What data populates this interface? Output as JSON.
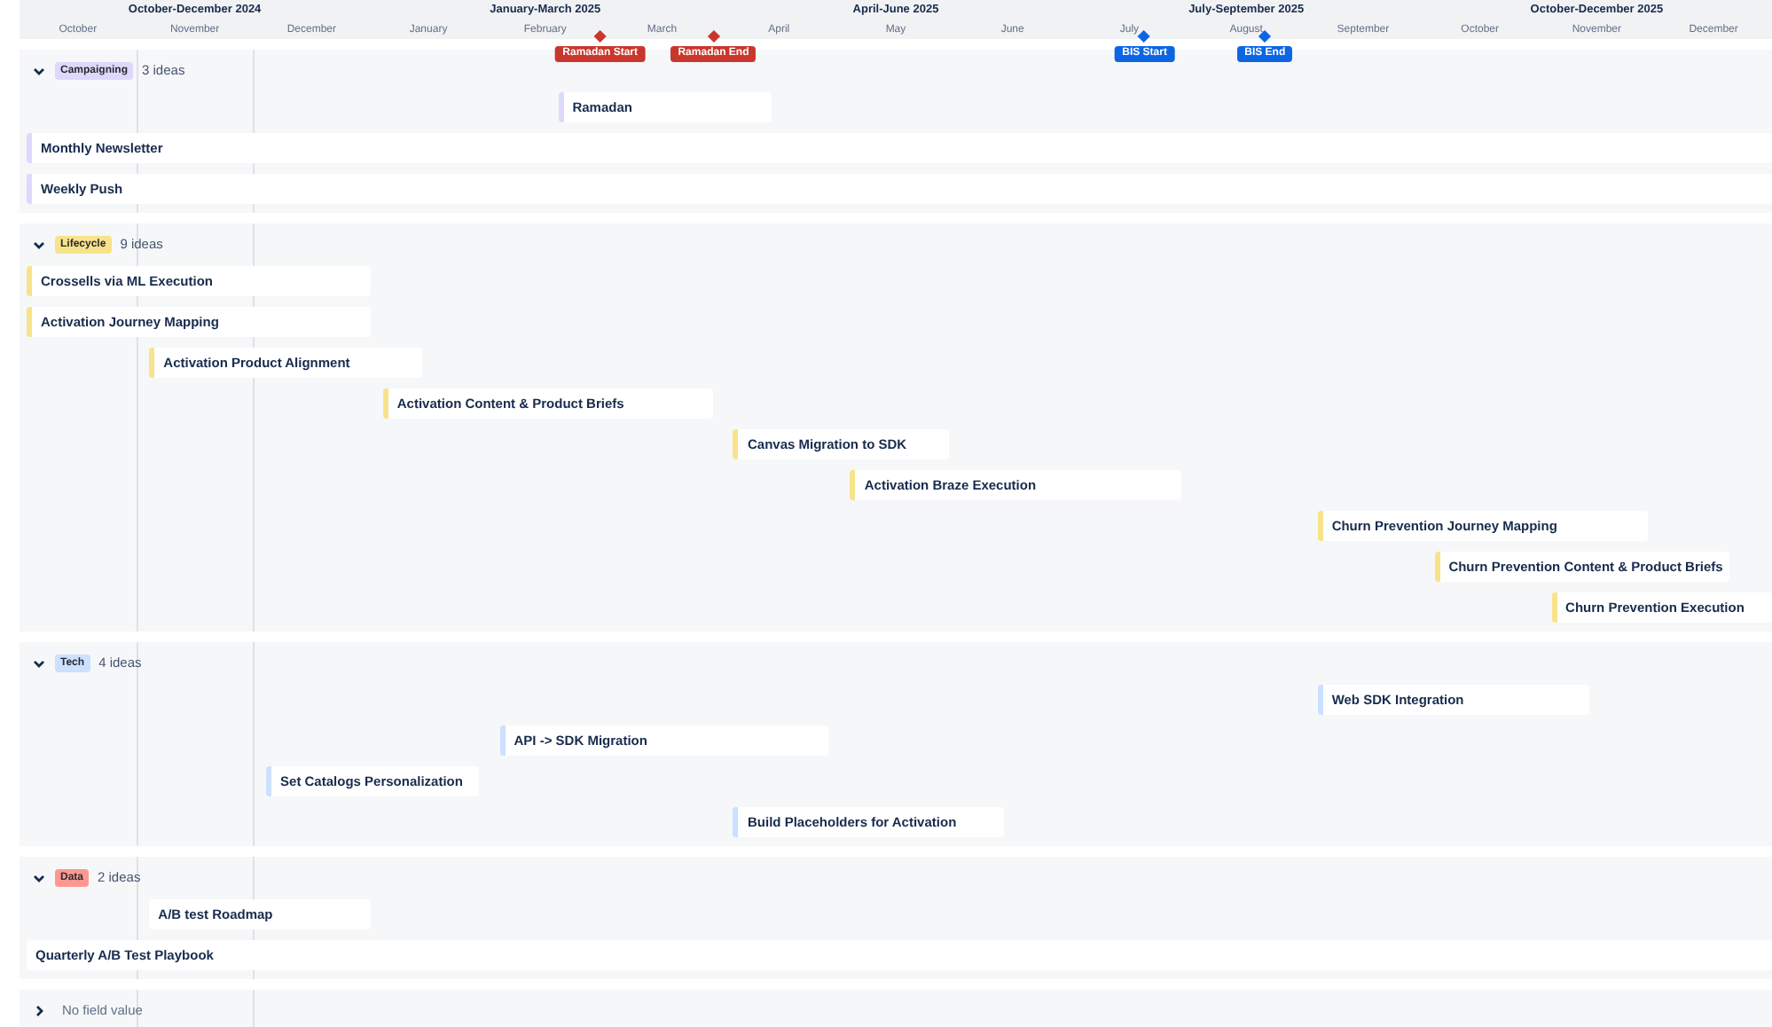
{
  "timeline": {
    "quarters": [
      {
        "label": "October-December 2024"
      },
      {
        "label": "January-March 2025"
      },
      {
        "label": "April-June 2025"
      },
      {
        "label": "July-September 2025"
      },
      {
        "label": "October-December 2025"
      }
    ],
    "months": [
      "October",
      "November",
      "December",
      "January",
      "February",
      "March",
      "April",
      "May",
      "June",
      "July",
      "August",
      "September",
      "October",
      "November",
      "December"
    ],
    "markers": [
      {
        "label": "Ramadan Start",
        "color": "#c9372c"
      },
      {
        "label": "Ramadan End",
        "color": "#c9372c"
      },
      {
        "label": "BIS Start",
        "color": "#0c66e4"
      },
      {
        "label": "BIS End",
        "color": "#0c66e4"
      }
    ]
  },
  "groups": [
    {
      "kind": "tag",
      "label": "Campaigning",
      "color": "#dfd8fd",
      "count": "3 ideas",
      "expanded": true,
      "items": [
        {
          "title": "Ramadan",
          "stripe": true
        },
        {
          "title": "Monthly Newsletter",
          "stripe": true
        },
        {
          "title": "Weekly Push",
          "stripe": true
        }
      ]
    },
    {
      "kind": "tag",
      "label": "Lifecycle",
      "color": "#f8e38b",
      "count": "9 ideas",
      "expanded": true,
      "items": [
        {
          "title": "Crossells via ML Execution",
          "stripe": true
        },
        {
          "title": "Activation Journey Mapping",
          "stripe": true
        },
        {
          "title": "Activation Product Alignment",
          "stripe": true
        },
        {
          "title": "Activation Content & Product Briefs",
          "stripe": true
        },
        {
          "title": "Canvas Migration to SDK",
          "stripe": true
        },
        {
          "title": "Activation Braze Execution",
          "stripe": true
        },
        {
          "title": "Churn Prevention Journey Mapping",
          "stripe": true
        },
        {
          "title": "Churn Prevention Content & Product Briefs",
          "stripe": true
        },
        {
          "title": "Churn Prevention Execution",
          "stripe": true
        }
      ]
    },
    {
      "kind": "tag",
      "label": "Tech",
      "color": "#cce0ff",
      "count": "4 ideas",
      "expanded": true,
      "items": [
        {
          "title": "Web SDK Integration",
          "stripe": true
        },
        {
          "title": "API -> SDK Migration",
          "stripe": true
        },
        {
          "title": "Set Catalogs Personalization",
          "stripe": true
        },
        {
          "title": "Build Placeholders for Activation",
          "stripe": true
        }
      ]
    },
    {
      "kind": "tag",
      "label": "Data",
      "color": "#fd9891",
      "count": "2 ideas",
      "expanded": true,
      "items": [
        {
          "title": "A/B test Roadmap",
          "stripe": false
        },
        {
          "title": "Quarterly A/B Test Playbook",
          "stripe": false
        }
      ]
    },
    {
      "kind": "plain",
      "label": "No field value",
      "expanded": false
    }
  ]
}
